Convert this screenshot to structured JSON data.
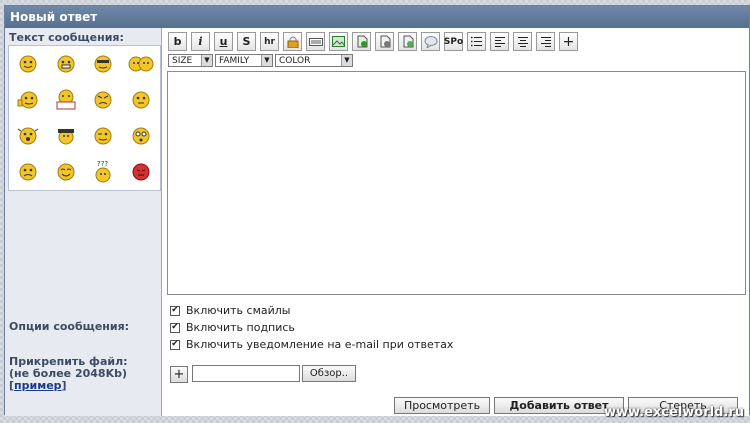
{
  "title": "Новый ответ",
  "message_label": "Текст сообщения:",
  "toolbar": {
    "buttons": [
      "b",
      "i",
      "u",
      "S",
      "hr",
      "lock",
      "code",
      "image",
      "flash",
      "audio",
      "video",
      "quote",
      "SPo",
      "ul",
      "align-left",
      "align-center",
      "align-right",
      "plus"
    ],
    "bold": "b",
    "italic": "i",
    "underline": "u",
    "strike": "S",
    "hr": "hr",
    "spoiler": "SPo",
    "plus": "+"
  },
  "selects": {
    "size": "SIZE",
    "family": "FAMILY",
    "color": "COLOR"
  },
  "options": {
    "label": "Опции сообщения:",
    "smiles": "Включить смайлы",
    "signature": "Включить подпись",
    "notify": "Включить уведомление на e-mail при ответах"
  },
  "attach": {
    "label_1": "Прикрепить файл:",
    "label_2": "(не более 2048Kb)",
    "example_bracket_open": "[",
    "example": "пример",
    "example_bracket_close": "]",
    "plus": "+",
    "browse": "Обзор..",
    "value": ""
  },
  "buttons": {
    "preview": "Просмотреть",
    "submit": "Добавить ответ",
    "clear": "Стереть"
  },
  "watermark": "www.excelworld.ru",
  "colors": {
    "header": "#5b7493",
    "label": "#3c4b63",
    "smile": "#f2c52a",
    "red": "#d63030"
  }
}
